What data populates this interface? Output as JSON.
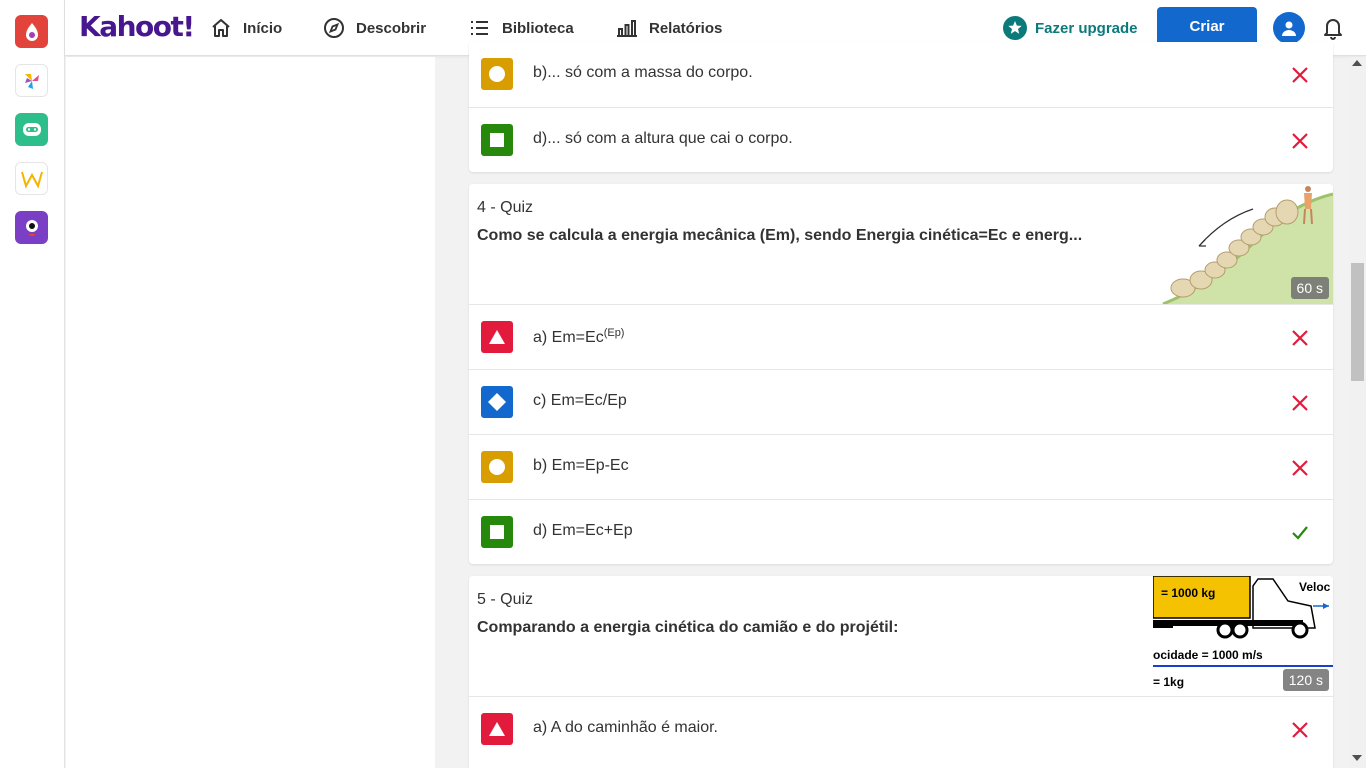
{
  "brand": {
    "logo": "Kahoot!"
  },
  "nav": {
    "items": [
      {
        "label": "Início",
        "icon": "home-icon"
      },
      {
        "label": "Descobrir",
        "icon": "compass-icon"
      },
      {
        "label": "Biblioteca",
        "icon": "list-icon"
      },
      {
        "label": "Relatórios",
        "icon": "bar-chart-icon"
      }
    ],
    "upgrade_label": "Fazer upgrade",
    "create_label": "Criar"
  },
  "rail_apps": [
    "kahoot-app-icon",
    "pinwheel-app-icon",
    "chat-app-icon",
    "w-app-icon",
    "eye-app-icon"
  ],
  "colors": {
    "brand_purple": "#46178f",
    "create_blue": "#1368ce",
    "upgrade_teal": "#0c7a7a",
    "red": "#e21b3c",
    "blue": "#1368ce",
    "yellow": "#d89e00",
    "green": "#26890c",
    "incorrect": "#e21b3c",
    "correct": "#26890c"
  },
  "prev_question": {
    "answers": [
      {
        "text": "b)... só com a massa do corpo.",
        "shape": "circle",
        "correct": false
      },
      {
        "text": "d)... só com a altura que cai o corpo.",
        "shape": "square",
        "correct": false
      }
    ]
  },
  "q4": {
    "type": "4 - Quiz",
    "title": "Como se calcula a energia mecânica (Em), sendo Energia cinética=Ec e energ...",
    "time": "60 s",
    "answers": [
      {
        "text": "a) Em=Ec",
        "sup": "(Ep)",
        "shape": "triangle",
        "correct": false
      },
      {
        "text": "c) Em=Ec/Ep",
        "shape": "diamond",
        "correct": false
      },
      {
        "text": "b) Em=Ep-Ec",
        "shape": "circle",
        "correct": false
      },
      {
        "text": "d) Em=Ec+Ep",
        "shape": "square",
        "correct": true
      }
    ]
  },
  "q5": {
    "type": "5 - Quiz",
    "title": "Comparando a energia cinética do camião e do projétil:",
    "time": "120 s",
    "image_text": {
      "truck_mass": "= 1000 kg",
      "velocity_label": "Veloc",
      "velocity": "ocidade = 1000 m/s",
      "mass": "= 1kg"
    },
    "answers": [
      {
        "text": "a) A do caminhão é maior.",
        "shape": "triangle",
        "correct": false
      }
    ]
  }
}
